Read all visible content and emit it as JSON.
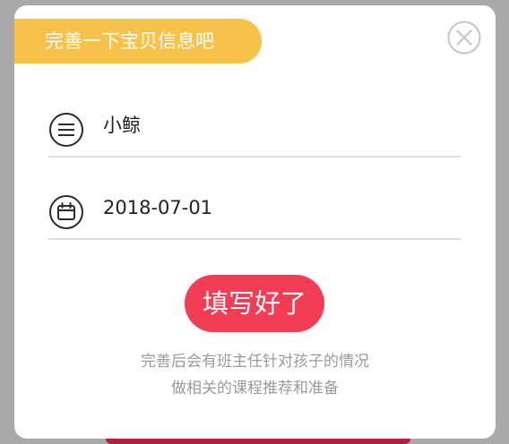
{
  "dialog": {
    "title": "完善一下宝贝信息吧",
    "close_icon": "close-circle-icon"
  },
  "fields": {
    "name": {
      "icon": "list-icon",
      "value": "小鲸"
    },
    "birthday": {
      "icon": "calendar-icon",
      "value": "2018-07-01"
    }
  },
  "actions": {
    "submit_label": "填写好了"
  },
  "hint": {
    "line1": "完善后会有班主任针对孩子的情况",
    "line2": "做相关的课程推荐和准备"
  },
  "colors": {
    "title_pill": "#f7c24a",
    "submit_button": "#f23d55",
    "overlay": "#a9a9a9",
    "hint_text": "#9a9a9a"
  }
}
